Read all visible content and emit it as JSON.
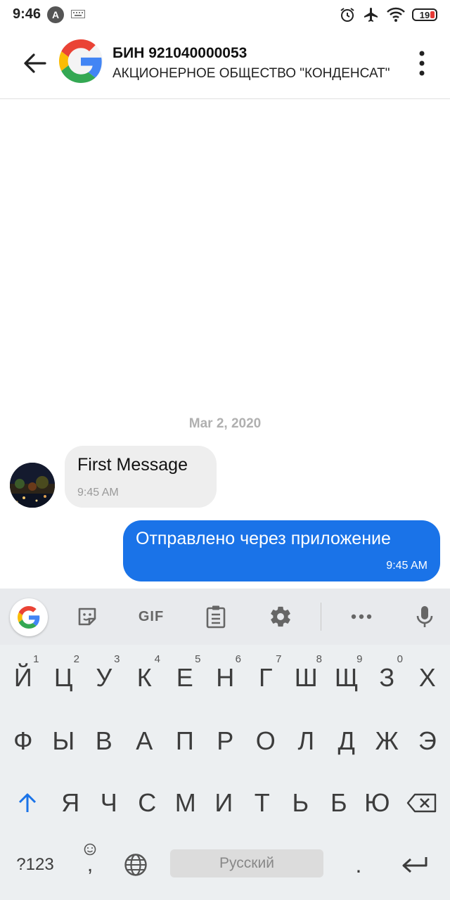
{
  "status_bar": {
    "time": "9:46",
    "badge": "A",
    "battery": "19"
  },
  "header": {
    "title": "БИН 921040000053",
    "subtitle": "АКЦИОНЕРНОЕ ОБЩЕСТВО \"КОНДЕНСАТ\""
  },
  "conversation": {
    "date": "Mar 2, 2020",
    "incoming": {
      "text": "First Message",
      "time": "9:45 AM"
    },
    "outgoing": {
      "text": "Отправлено через приложение",
      "time": "9:45 AM"
    }
  },
  "keyboard": {
    "toolbar": {
      "gif_label": "GIF"
    },
    "row1": [
      "Й",
      "Ц",
      "У",
      "К",
      "Е",
      "Н",
      "Г",
      "Ш",
      "Щ",
      "З",
      "Х"
    ],
    "row1_hints": [
      "1",
      "2",
      "3",
      "4",
      "5",
      "6",
      "7",
      "8",
      "9",
      "0",
      ""
    ],
    "row2": [
      "Ф",
      "Ы",
      "В",
      "А",
      "П",
      "Р",
      "О",
      "Л",
      "Д",
      "Ж",
      "Э"
    ],
    "row3": [
      "Я",
      "Ч",
      "С",
      "М",
      "И",
      "Т",
      "Ь",
      "Б",
      "Ю"
    ],
    "symbols_label": "?123",
    "comma": ",",
    "space_label": "Русский",
    "period": "."
  },
  "colors": {
    "accent": "#1a73e8",
    "incoming_bubble": "#eeeeee",
    "keyboard_bg": "#eceff1"
  }
}
